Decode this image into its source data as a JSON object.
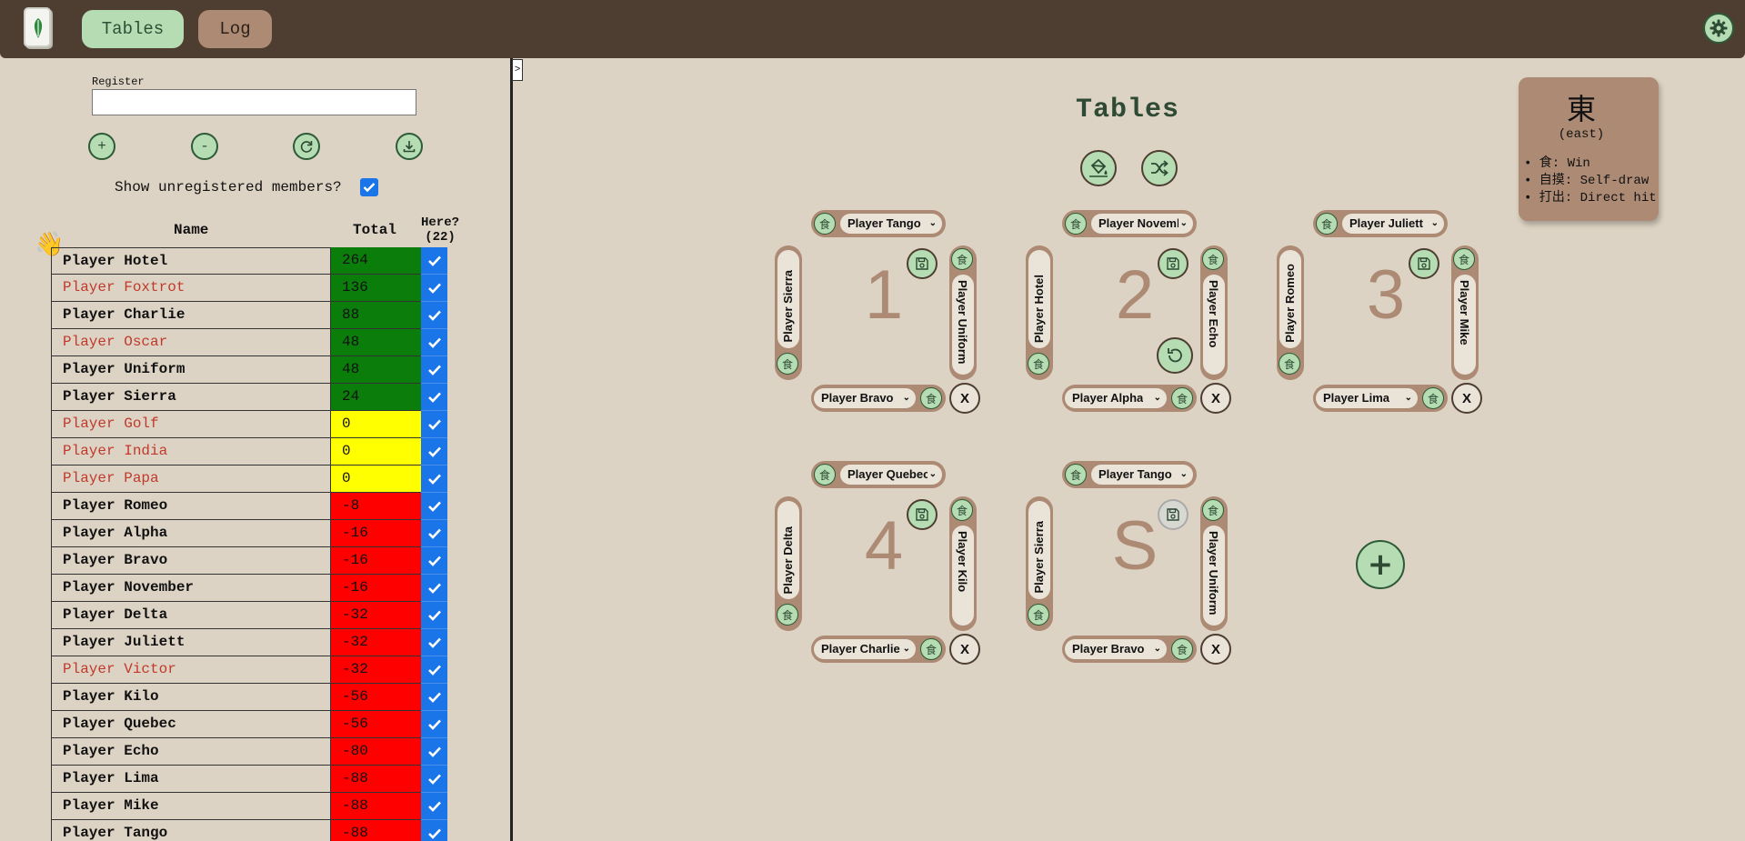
{
  "header": {
    "tabs": [
      {
        "label": "Tables"
      },
      {
        "label": "Log"
      }
    ],
    "logo_icon": "mahjong-tile-icon",
    "settings_icon": "gear-icon"
  },
  "sidebar": {
    "collapse_label": ">",
    "register_label": "Register",
    "register_value": "",
    "buttons": [
      {
        "label": "+"
      },
      {
        "label": "-"
      },
      {
        "icon": "refresh-icon"
      },
      {
        "icon": "download-icon"
      }
    ],
    "show_unregistered_label": "Show unregistered members?",
    "show_unregistered_checked": true,
    "columns": {
      "name": "Name",
      "total": "Total",
      "here": "Here?",
      "here_count": "(22)"
    },
    "players": [
      {
        "name": "Player Hotel",
        "total": "264",
        "registered": true,
        "here": true
      },
      {
        "name": "Player Foxtrot",
        "total": "136",
        "registered": false,
        "here": true
      },
      {
        "name": "Player Charlie",
        "total": "88",
        "registered": true,
        "here": true
      },
      {
        "name": "Player Oscar",
        "total": "48",
        "registered": false,
        "here": true
      },
      {
        "name": "Player Uniform",
        "total": "48",
        "registered": true,
        "here": true
      },
      {
        "name": "Player Sierra",
        "total": "24",
        "registered": true,
        "here": true
      },
      {
        "name": "Player Golf",
        "total": "0",
        "registered": false,
        "here": true
      },
      {
        "name": "Player India",
        "total": "0",
        "registered": false,
        "here": true
      },
      {
        "name": "Player Papa",
        "total": "0",
        "registered": false,
        "here": true
      },
      {
        "name": "Player Romeo",
        "total": "-8",
        "registered": true,
        "here": true
      },
      {
        "name": "Player Alpha",
        "total": "-16",
        "registered": true,
        "here": true
      },
      {
        "name": "Player Bravo",
        "total": "-16",
        "registered": true,
        "here": true
      },
      {
        "name": "Player November",
        "total": "-16",
        "registered": true,
        "here": true
      },
      {
        "name": "Player Delta",
        "total": "-32",
        "registered": true,
        "here": true
      },
      {
        "name": "Player Juliett",
        "total": "-32",
        "registered": true,
        "here": true
      },
      {
        "name": "Player Victor",
        "total": "-32",
        "registered": false,
        "here": true
      },
      {
        "name": "Player Kilo",
        "total": "-56",
        "registered": true,
        "here": true
      },
      {
        "name": "Player Quebec",
        "total": "-56",
        "registered": true,
        "here": true
      },
      {
        "name": "Player Echo",
        "total": "-80",
        "registered": true,
        "here": true
      },
      {
        "name": "Player Lima",
        "total": "-88",
        "registered": true,
        "here": true
      },
      {
        "name": "Player Mike",
        "total": "-88",
        "registered": true,
        "here": true
      },
      {
        "name": "Player Tango",
        "total": "-88",
        "registered": true,
        "here": true
      }
    ]
  },
  "main": {
    "title": "Tables",
    "wind_card": {
      "char": "東",
      "name": "(east)",
      "legend": [
        "• 食: Win",
        "• 自摸: Self-draw",
        "• 打出: Direct hit"
      ]
    },
    "seat_icon_char": "食",
    "tables": [
      {
        "label": "1",
        "top": "Player Tango",
        "left": "Player Sierra",
        "right": "Player Uniform",
        "bottom": "Player Bravo",
        "show_undo": false,
        "save_disabled": false
      },
      {
        "label": "2",
        "top": "Player November",
        "left": "Player Hotel",
        "right": "Player Echo",
        "bottom": "Player Alpha",
        "show_undo": true,
        "save_disabled": false
      },
      {
        "label": "3",
        "top": "Player Juliett",
        "left": "Player Romeo",
        "right": "Player Mike",
        "bottom": "Player Lima",
        "show_undo": false,
        "save_disabled": false
      },
      {
        "label": "4",
        "top": "Player Quebec",
        "left": "Player Delta",
        "right": "Player Kilo",
        "bottom": "Player Charlie",
        "show_undo": false,
        "save_disabled": false
      },
      {
        "label": "S",
        "top": "Player Tango",
        "left": "Player Sierra",
        "right": "Player Uniform",
        "bottom": "Player Bravo",
        "show_undo": false,
        "save_disabled": true
      }
    ],
    "remove_label": "X",
    "add_table_label": "+"
  }
}
